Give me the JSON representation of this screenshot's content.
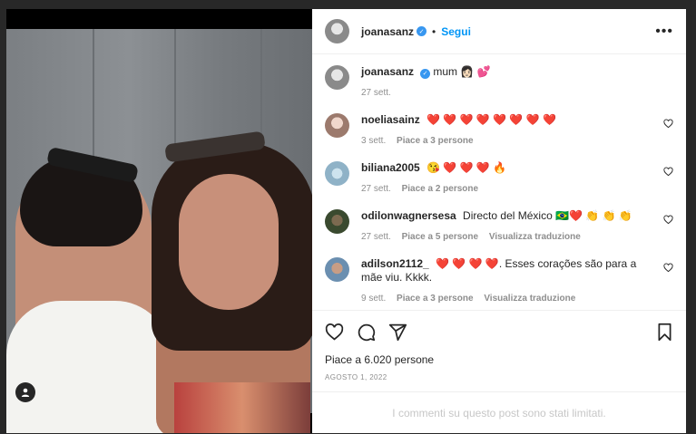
{
  "post": {
    "author": "joanasanz",
    "follow_label": "Segui",
    "dot": "•",
    "more_label": "•••",
    "caption": {
      "username": "joanasanz",
      "text": "mum 👩🏻 💕",
      "time": "27 sett."
    },
    "comments": [
      {
        "username": "noeliasainz",
        "text": "❤️ ❤️ ❤️ ❤️ ❤️ ❤️ ❤️ ❤️",
        "time": "3 sett.",
        "likes": "Piace a 3 persone",
        "translate": ""
      },
      {
        "username": "biliana2005",
        "text": "😘 ❤️ ❤️ ❤️ 🔥",
        "time": "27 sett.",
        "likes": "Piace a 2 persone",
        "translate": ""
      },
      {
        "username": "odilonwagnersesa",
        "text": "Directo del México 🇧🇷❤️ 👏 👏 👏",
        "time": "27 sett.",
        "likes": "Piace a 5 persone",
        "translate": "Visualizza traduzione"
      },
      {
        "username": "adilson2112_",
        "text": "❤️ ❤️ ❤️ ❤️. Esses corações são para a mãe viu. Kkkk.",
        "time": "9 sett.",
        "likes": "Piace a 3 persone",
        "translate": "Visualizza traduzione"
      }
    ],
    "likes_text": "Piace a 6.020 persone",
    "date": "AGOSTO 1, 2022",
    "comments_limited": "I commenti su questo post sono stati limitati."
  }
}
